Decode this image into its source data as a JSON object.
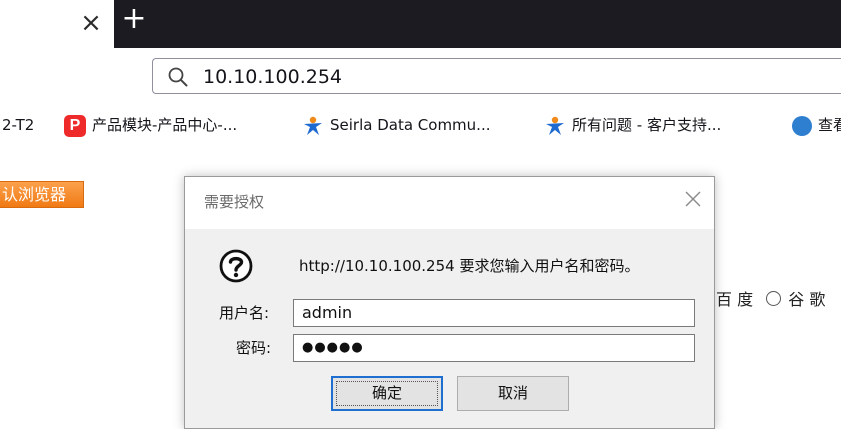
{
  "tabs": {
    "close_glyph": "×",
    "new_tab_glyph": "+"
  },
  "address_bar": {
    "url": "10.10.100.254",
    "icon": "search-icon"
  },
  "bookmarks": [
    {
      "label": "2-T2",
      "icon": ""
    },
    {
      "label": "产品模块-产品中心-...",
      "icon": "p-logo-icon"
    },
    {
      "label": "Seirla Data Commu...",
      "icon": "person-star-icon"
    },
    {
      "label": "所有问题 - 客户支持...",
      "icon": "person-star-icon"
    },
    {
      "label": "查看",
      "icon": "globe-icon"
    }
  ],
  "page": {
    "orange_button_label": "认浏览器",
    "engine_option_1": "百 度",
    "engine_option_2": "谷 歌"
  },
  "dialog": {
    "title": "需要授权",
    "message": "http://10.10.100.254 要求您输入用户名和密码。",
    "username_label": "用户名:",
    "username_value": "admin",
    "password_label": "密码:",
    "password_value": "●●●●●",
    "ok_label": "确定",
    "cancel_label": "取消"
  },
  "colors": {
    "tabstrip_dark": "#1c1b22",
    "orange": "#f07a14",
    "focus_blue": "#1f6fd1"
  }
}
